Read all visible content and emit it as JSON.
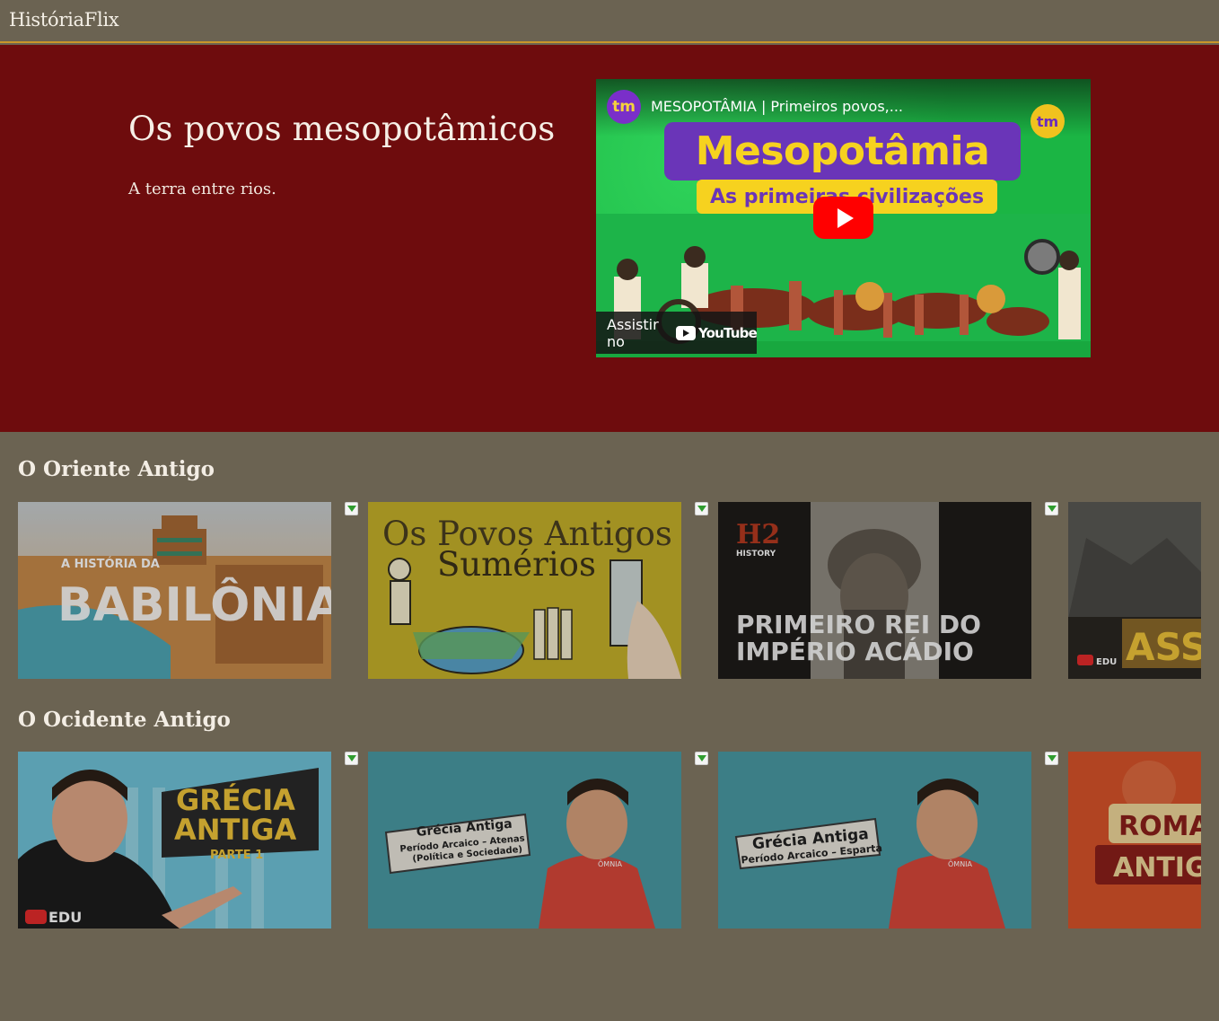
{
  "app": {
    "brand": "HistóriaFlix"
  },
  "hero": {
    "title": "Os povos mesopotâmicos",
    "subtitle": "A terra entre rios.",
    "video": {
      "channel_badge": "tm",
      "title": "MESOPOTÂMIA | Primeiros povos,...",
      "thumb_heading": "Mesopotâmia",
      "thumb_subheading": "As primeiras civilizações",
      "corner_badge": "tm",
      "watch_on": "Assistir no",
      "youtube_word": "YouTube"
    }
  },
  "sections": [
    {
      "title": "O Oriente Antigo",
      "cards": [
        {
          "top_text": "A HISTÓRIA DA",
          "main_text": "BABILÔNIA",
          "colors": {
            "bg": "#c78a4a"
          }
        },
        {
          "line1": "Os Povos Antigos",
          "line2": "Sumérios",
          "colors": {
            "bg": "#c6b12a"
          }
        },
        {
          "brand": "H2",
          "brand_sub": "HISTORY",
          "line1": "PRIMEIRO REI DO",
          "line2": "IMPÉRIO ACÁDIO",
          "colors": {
            "bg": "#1e1c19"
          }
        },
        {
          "badge": "EDU",
          "main_text": "ASS",
          "colors": {
            "bg": "#3a3a3a"
          }
        }
      ]
    },
    {
      "title": "O Ocidente Antigo",
      "cards": [
        {
          "line1": "GRÉCIA",
          "line2": "ANTIGA",
          "line3": "PARTE 1",
          "badge": "EDU",
          "colors": {
            "bg": "#6fc3d8"
          }
        },
        {
          "line1": "Grécia Antiga",
          "line2": "Período Arcaico – Atenas",
          "line3": "(Política e Sociedade)",
          "shirt": "ÔMNIA",
          "colors": {
            "bg": "#4a9aa4"
          }
        },
        {
          "line1": "Grécia Antiga",
          "line2": "Período Arcaico – Esparta",
          "shirt": "ÔMNIA",
          "colors": {
            "bg": "#4a9aa4"
          }
        },
        {
          "line1": "ROMA",
          "line2": "ANTIG",
          "colors": {
            "bg": "#d8542a"
          }
        }
      ]
    }
  ],
  "icons": {
    "download": "download-arrow-icon",
    "play": "play-icon"
  },
  "colors": {
    "header_bg": "#6b6352",
    "accent_line": "#c9962a",
    "hero_bg": "#6e0c0d",
    "page_bg": "#6b6352"
  }
}
